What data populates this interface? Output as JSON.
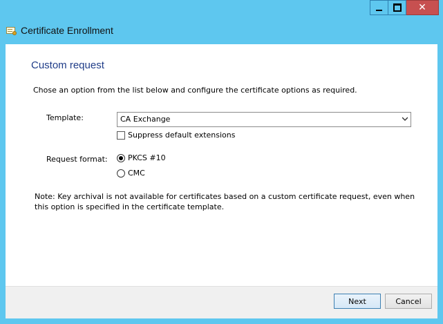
{
  "window": {
    "title": "Certificate Enrollment",
    "caption_buttons": {
      "minimize": "minimize-icon",
      "maximize": "maximize-icon",
      "close": "close-icon"
    },
    "close_color": "#c75050",
    "frame_color": "#5ec7ef"
  },
  "page": {
    "heading": "Custom request",
    "heading_color": "#1f3c88",
    "description": "Chose an option from the list below and configure the certificate options as required."
  },
  "form": {
    "template_label": "Template:",
    "template_value": "CA Exchange",
    "suppress_label": "Suppress default extensions",
    "suppress_checked": false,
    "format_label": "Request format:",
    "format_options": [
      {
        "label": "PKCS #10",
        "selected": true
      },
      {
        "label": "CMC",
        "selected": false
      }
    ]
  },
  "note": "Note: Key archival is not available for certificates based on a custom certificate request, even when this option is specified in the certificate template.",
  "footer": {
    "next_label": "Next",
    "cancel_label": "Cancel"
  }
}
